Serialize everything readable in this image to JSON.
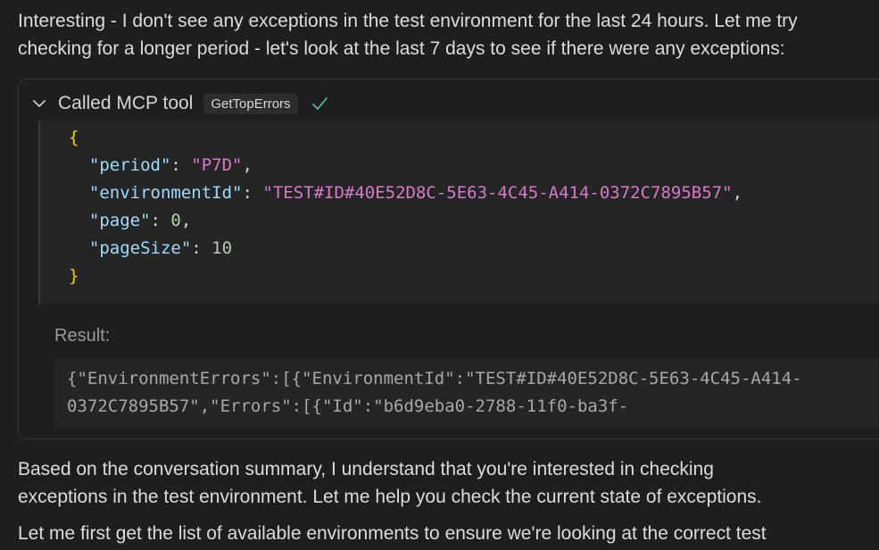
{
  "messages": {
    "intro": {
      "line1": "Interesting - I don't see any exceptions in the test environment for the last 24 hours. Let me try",
      "line2": "checking for a longer period - let's look at the last 7 days to see if there were any exceptions:"
    },
    "summary": {
      "line1": "Based on the conversation summary, I understand that you're interested in checking",
      "line2": "exceptions in the test environment. Let me help you check the current state of exceptions."
    },
    "next": {
      "line1": "Let me first get the list of available environments to ensure we're looking at the correct test"
    }
  },
  "tool_call": {
    "label": "Called MCP tool",
    "tool_name": "GetTopErrors",
    "icons": {
      "toggle": "chevron-down-icon",
      "status": "checkmark-icon",
      "status_color": "#4ec9b0"
    },
    "args": {
      "open_brace": "{",
      "close_brace": "}",
      "period_key": "\"period\"",
      "period_value": "\"P7D\"",
      "environment_key": "\"environmentId\"",
      "environment_value": "\"TEST#ID#40E52D8C-5E63-4C45-A414-0372C7895B57\"",
      "page_key": "\"page\"",
      "page_value": "0",
      "page_size_key": "\"pageSize\"",
      "page_size_value": "10"
    },
    "result_label": "Result:",
    "result_lines": [
      "{\"EnvironmentErrors\":[{\"EnvironmentId\":\"TEST#ID#40E52D8C-5E63-4C45-A414-",
      "0372C7895B57\",\"Errors\":[{\"Id\":\"b6d9eba0-2788-11f0-ba3f-"
    ]
  }
}
